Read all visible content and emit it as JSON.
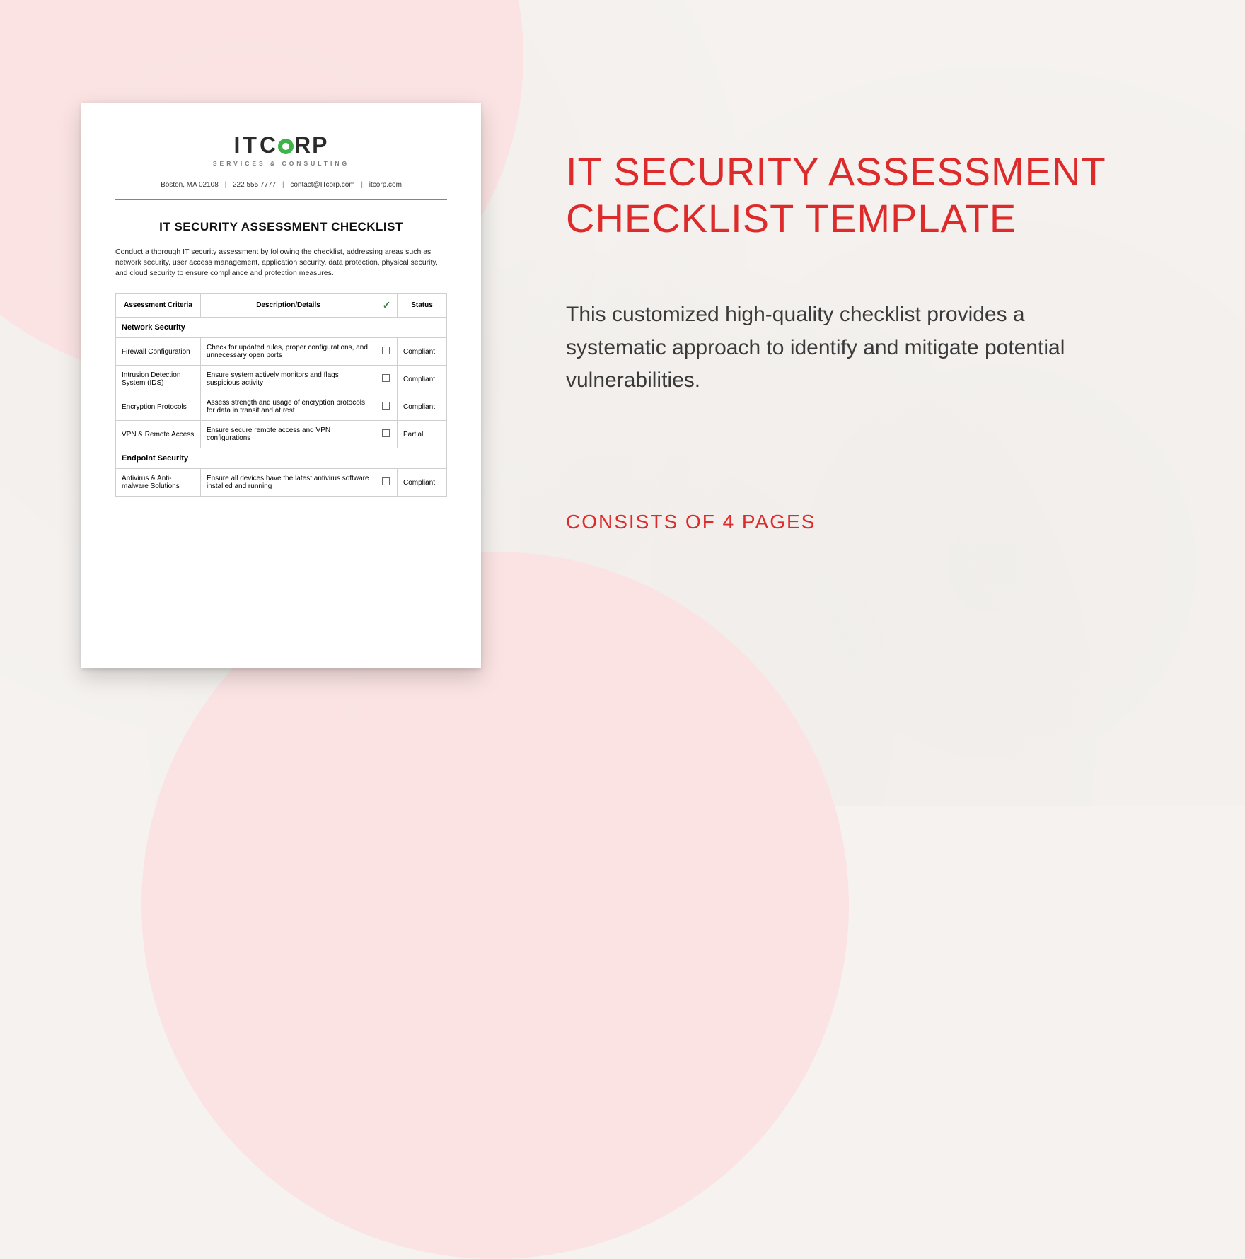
{
  "doc": {
    "logo": {
      "it": "IT",
      "c": "C",
      "rp": "RP",
      "sub": "SERVICES & CONSULTING"
    },
    "contact": {
      "city": "Boston, MA 02108",
      "phone": "222 555 7777",
      "email": "contact@ITcorp.com",
      "site": "itcorp.com"
    },
    "title": "IT SECURITY ASSESSMENT CHECKLIST",
    "intro": "Conduct a thorough IT security assessment by following the checklist, addressing areas such as network security, user access management, application security, data protection, physical security, and cloud security to ensure compliance and protection measures.",
    "headers": {
      "criteria": "Assessment Criteria",
      "desc": "Description/Details",
      "check": "✓",
      "status": "Status"
    },
    "sections": [
      {
        "name": "Network Security",
        "rows": [
          {
            "criteria": "Firewall Configuration",
            "desc": "Check for updated rules, proper configurations, and unnecessary open ports",
            "status": "Compliant"
          },
          {
            "criteria": "Intrusion Detection System (IDS)",
            "desc": "Ensure system actively monitors and flags suspicious activity",
            "status": "Compliant"
          },
          {
            "criteria": "Encryption Protocols",
            "desc": "Assess strength and usage of encryption protocols for data in transit and at rest",
            "status": "Compliant"
          },
          {
            "criteria": "VPN & Remote Access",
            "desc": "Ensure secure remote access and VPN configurations",
            "status": "Partial"
          }
        ]
      },
      {
        "name": "Endpoint Security",
        "rows": [
          {
            "criteria": "Antivirus & Anti-malware Solutions",
            "desc": "Ensure all devices have the latest antivirus software installed and running",
            "status": "Compliant"
          }
        ]
      }
    ]
  },
  "right": {
    "headline": "IT SECURITY ASSESSMENT CHECKLIST TEMPLATE",
    "blurb": "This customized high-quality checklist provides a systematic approach to identify and mitigate potential vulnerabilities.",
    "pages": "CONSISTS OF 4 PAGES"
  }
}
